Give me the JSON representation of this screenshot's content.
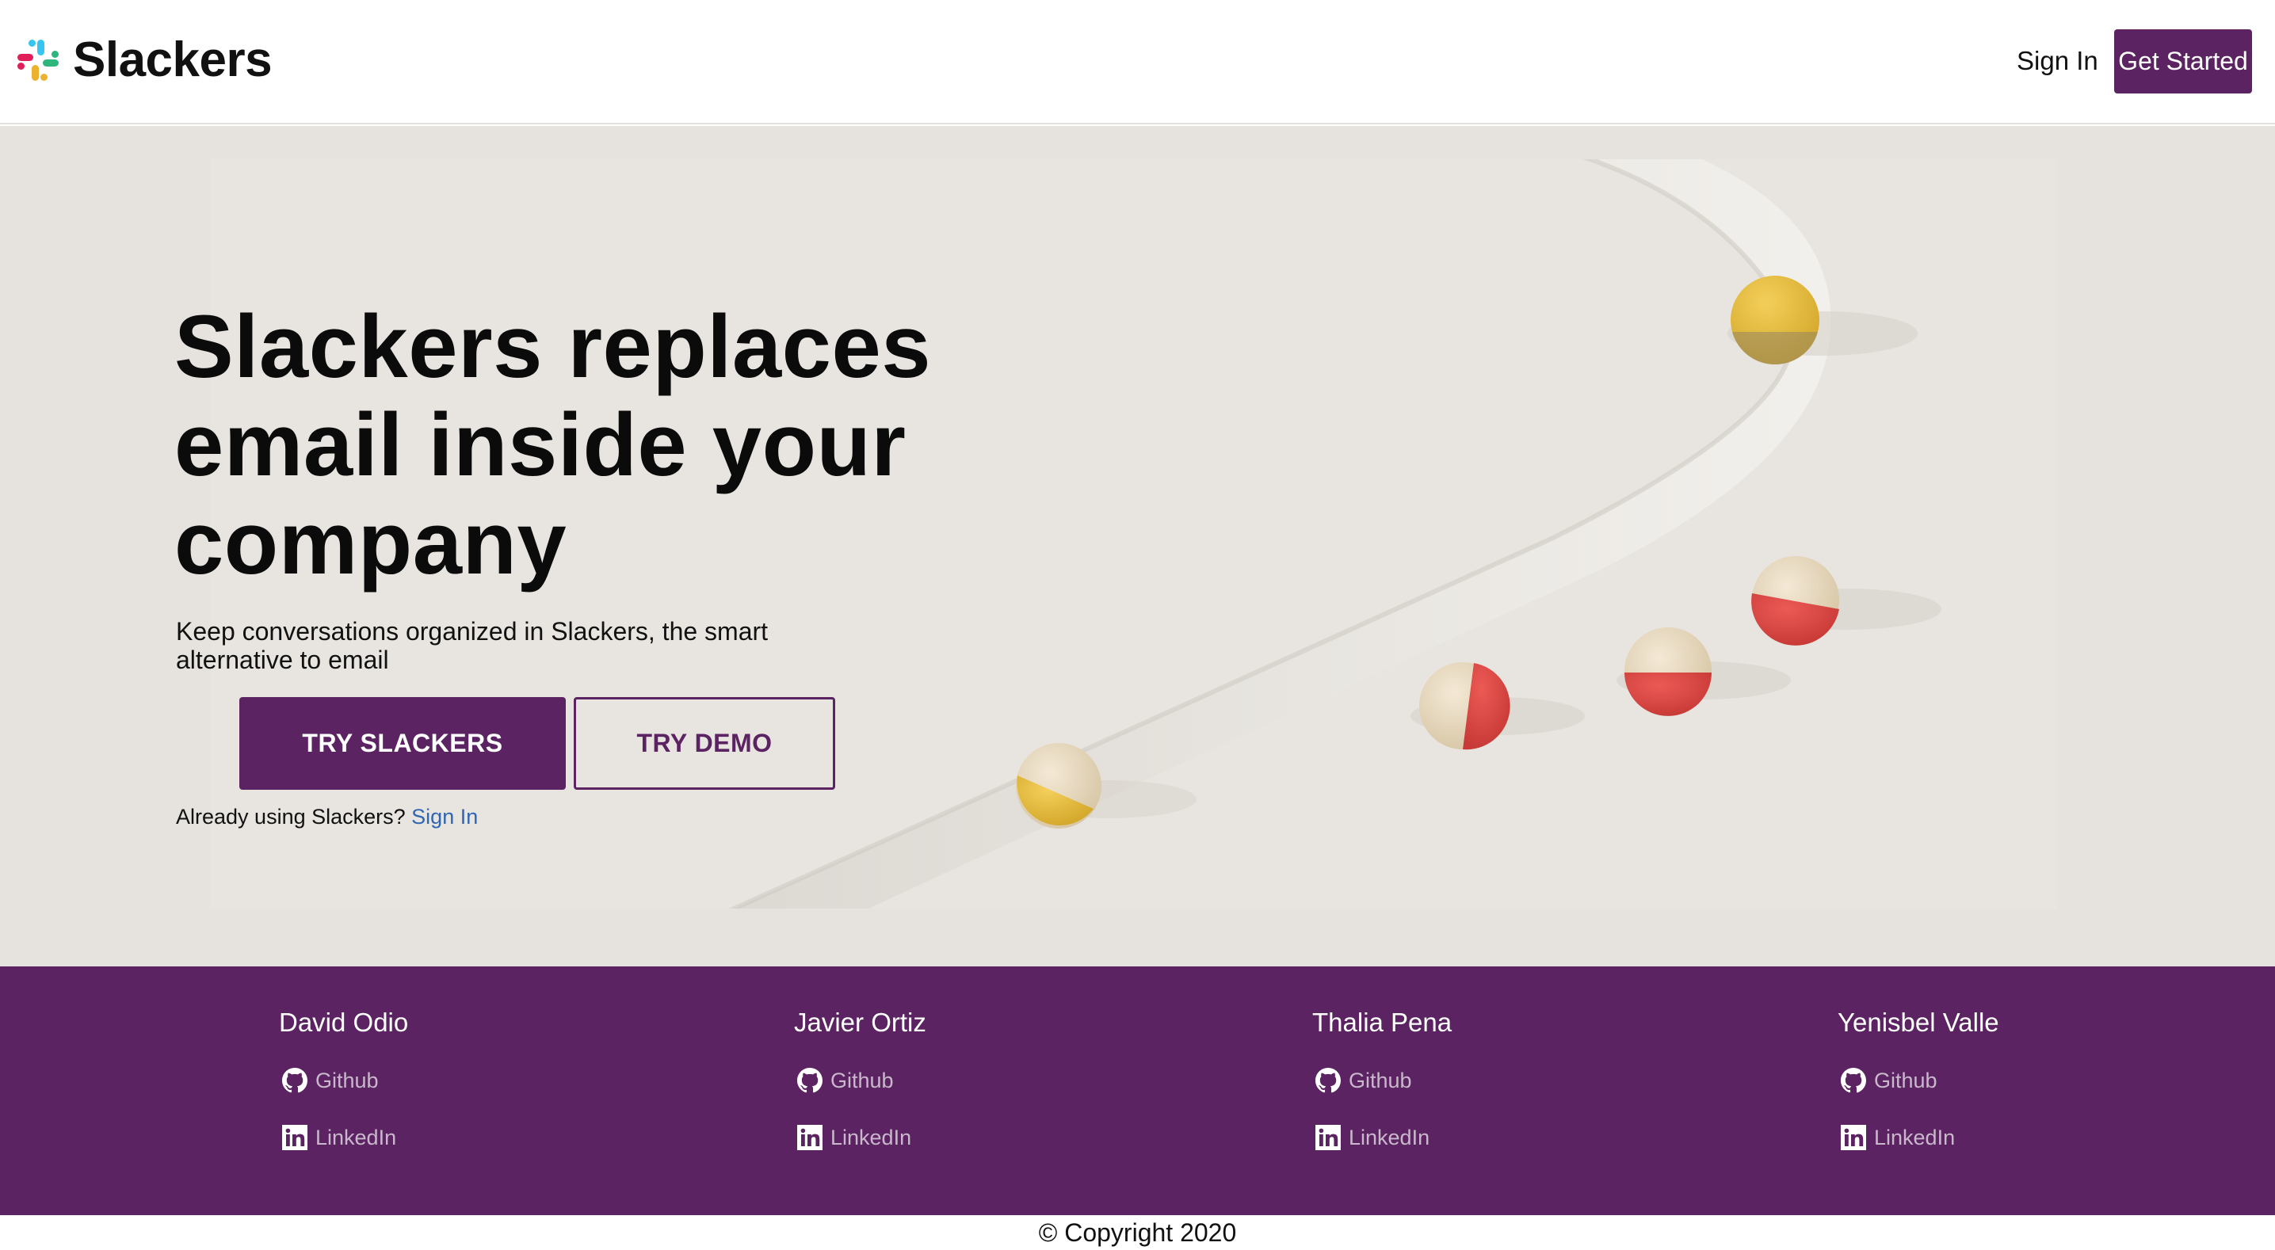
{
  "header": {
    "brand": "Slackers",
    "sign_in": "Sign In",
    "get_started": "Get Started"
  },
  "hero": {
    "title": "Slackers replaces email inside your company",
    "subtitle": "Keep conversations organized in Slackers, the smart alternative to email",
    "try_slackers": "TRY SLACKERS",
    "try_demo": "TRY DEMO",
    "already_text": "Already using Slackers?",
    "already_link": "Sign In"
  },
  "team": [
    {
      "name": "David Odio",
      "github": "Github",
      "linkedin": "LinkedIn"
    },
    {
      "name": "Javier Ortiz",
      "github": "Github",
      "linkedin": "LinkedIn"
    },
    {
      "name": "Thalia Pena",
      "github": "Github",
      "linkedin": "LinkedIn"
    },
    {
      "name": "Yenisbel Valle",
      "github": "Github",
      "linkedin": "LinkedIn"
    }
  ],
  "footer": {
    "copyright": "© Copyright 2020"
  },
  "colors": {
    "brand_purple": "#5c2363",
    "hero_background": "#e6e3de",
    "link_blue": "#2f66b3"
  }
}
